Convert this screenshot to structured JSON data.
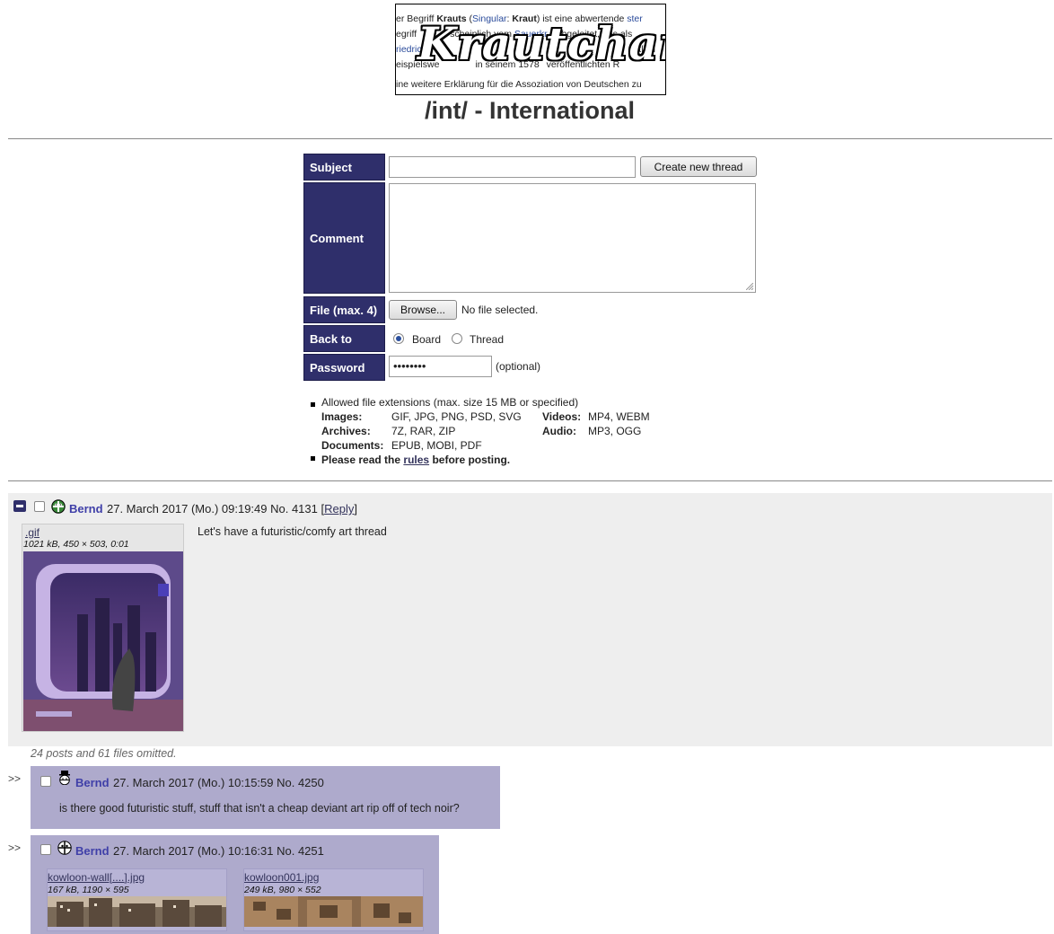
{
  "banner": {
    "lines": [
      {
        "parts": [
          "er Begriff ",
          "Krauts",
          " (",
          "Singular",
          ": ",
          "Kraut",
          ") ist eine abwertende ",
          "ster"
        ]
      },
      {
        "parts": [
          "egriff ",
          "",
          "scheinlich vom ",
          "Sauerkr",
          "abgeleitet, das als"
        ]
      },
      {
        "parts": [
          "riedrich",
          "",
          "",
          "",
          "",
          "utlich"
        ]
      },
      {
        "parts": [
          "eispielswe",
          "",
          "in seinem ",
          "1578",
          "veröffentlichten R"
        ]
      },
      {
        "parts": [
          "ine weitere Erklärung für die Assoziation von Deutschen zu"
        ]
      }
    ],
    "logo_text": "Krautchan"
  },
  "board_title": "/int/ - International",
  "form": {
    "subject_label": "Subject",
    "create_button": "Create new thread",
    "comment_label": "Comment",
    "file_label": "File (max. 4)",
    "browse_button": "Browse...",
    "no_file": "No file selected.",
    "back_to_label": "Back to",
    "radio_board": "Board",
    "radio_thread": "Thread",
    "password_label": "Password",
    "password_value": "••••••••",
    "optional": "(optional)"
  },
  "rules": {
    "allowed": "Allowed file extensions (max. size 15 MB or specified)",
    "images_label": "Images:",
    "images": "GIF, JPG, PNG, PSD, SVG",
    "videos_label": "Videos:",
    "videos": "MP4, WEBM",
    "archives_label": "Archives:",
    "archives": "7Z, RAR, ZIP",
    "audio_label": "Audio:",
    "audio": "MP3, OGG",
    "documents_label": "Documents:",
    "documents": "EPUB, MOBI, PDF",
    "read_pre": "Please read the",
    "rules_link": "rules",
    "read_post": "before posting."
  },
  "thread": {
    "op": {
      "name": "Bernd",
      "date": "27. March 2017 (Mo.) 09:19:49 No. 4131 [",
      "reply_link": "Reply",
      "reply_close": "]",
      "file_name": ".gif",
      "file_info": "1021 kB, 450 × 503, 0:01",
      "text": "Let's have a futuristic/comfy art thread"
    },
    "omitted": "24 posts and 61 files omitted.",
    "replies": [
      {
        "arrows": ">>",
        "name": "Bernd",
        "meta": "27. March 2017 (Mo.) 10:15:59 No. 4250",
        "text": "is there good futuristic stuff, stuff that isn't a cheap deviant art rip off of tech noir?"
      },
      {
        "arrows": ">>",
        "name": "Bernd",
        "meta": "27. March 2017 (Mo.) 10:16:31 No. 4251",
        "files": [
          {
            "name": "kowloon-wall[....].jpg",
            "info": "167 kB, 1190 × 595"
          },
          {
            "name": "kowloon001.jpg",
            "info": "249 kB, 980 × 552"
          }
        ]
      }
    ]
  },
  "colors": {
    "label_bg": "#2f2f6b",
    "thread_bg": "#eeeeee",
    "reply_bg": "#aeaacc",
    "name": "#3f3fa8"
  }
}
